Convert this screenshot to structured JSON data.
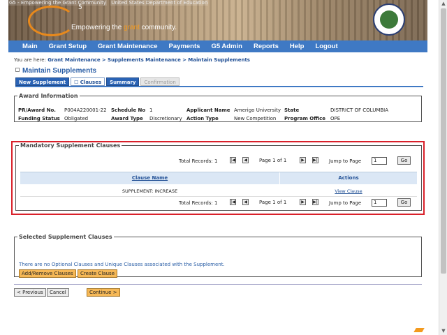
{
  "banner": {
    "alt_text_1": "G5 - Empowering the Grant Community",
    "alt_text_2": "United States Department of Education",
    "logo_text": "5",
    "tagline_pre": "Empowering the ",
    "tagline_hl": "grant",
    "tagline_post": " community."
  },
  "nav": {
    "items": [
      "Main",
      "Grant Setup",
      "Grant Maintenance",
      "Payments",
      "G5 Admin",
      "Reports",
      "Help",
      "Logout"
    ]
  },
  "breadcrumb": {
    "prefix": "You are here:",
    "items": [
      "Grant Maintenance",
      "Supplements Maintenance",
      "Maintain Supplements"
    ],
    "separator": ">"
  },
  "page_title": "Maintain Supplements",
  "tabs": [
    {
      "label": "New Supplement",
      "state": "normal"
    },
    {
      "label": "Clauses",
      "state": "active"
    },
    {
      "label": "Summary",
      "state": "normal"
    },
    {
      "label": "Confirmation",
      "state": "disabled"
    }
  ],
  "award": {
    "legend": "Award Information",
    "pr_label": "PR/Award No.",
    "pr_value": "P004A220001-22",
    "schedule_label": "Schedule No",
    "schedule_value": "1",
    "applicant_label": "Applicant Name",
    "applicant_value": "Amerigo University",
    "state_label": "State",
    "state_value": "DISTRICT OF COLUMBIA",
    "funding_label": "Funding Status",
    "funding_value": "Obligated",
    "award_type_label": "Award Type",
    "award_type_value": "Discretionary",
    "action_label": "Action Type",
    "action_value": "New Competition",
    "office_label": "Program Office",
    "office_value": "OPE"
  },
  "mandatory": {
    "legend": "Mandatory Supplement Clauses",
    "total_records": "Total Records: 1",
    "page_of": "Page 1 of 1",
    "jump_label": "Jump to Page",
    "jump_value": "1",
    "go_label": "Go",
    "col_clause": "Clause Name",
    "col_actions": "Actions",
    "rows": [
      {
        "clause": "SUPPLEMENT: INCREASE",
        "action": "View Clause"
      }
    ]
  },
  "selected": {
    "legend": "Selected Supplement Clauses",
    "message": "There are no Optional Clauses and Unique Clauses associated with the Supplement.",
    "add_remove_label": "Add/Remove Clauses",
    "create_label": "Create Clause"
  },
  "footer": {
    "previous_label": "< Previous",
    "cancel_label": "Cancel",
    "continue_label": "Continue >"
  }
}
